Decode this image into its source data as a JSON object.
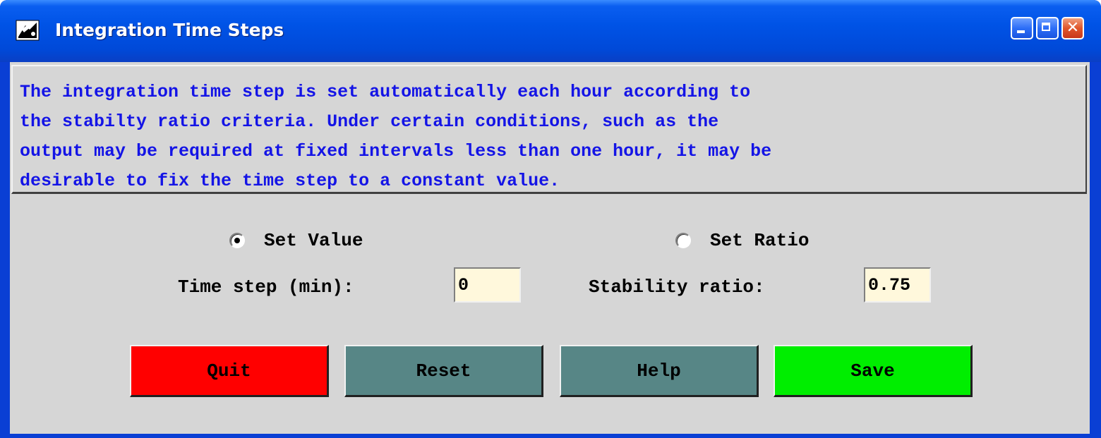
{
  "window": {
    "title": "Integration Time Steps",
    "icon": "app-icon",
    "controls": [
      "minimize-icon",
      "maximize-icon",
      "close-icon"
    ],
    "close_glyph": "✕"
  },
  "info": {
    "lines": [
      "The integration time step is set automatically each hour according to",
      "the stabilty ratio criteria. Under certain conditions, such as the",
      "output may be required at fixed intervals less than one hour, it may be",
      "desirable to fix the time step to a constant value."
    ],
    "color": "#1414e6"
  },
  "options": {
    "set_value_label": "Set Value",
    "set_value_checked": true,
    "set_ratio_label": "Set Ratio",
    "set_ratio_checked": false
  },
  "fields": {
    "time_step_label": "Time step (min):",
    "time_step_value": "0",
    "stability_label": "Stability ratio:",
    "stability_value": "0.75",
    "field_bg": "#fff8dc"
  },
  "buttons": {
    "quit": {
      "label": "Quit",
      "color": "#ff0000"
    },
    "reset": {
      "label": "Reset",
      "color": "#578686"
    },
    "help": {
      "label": "Help",
      "color": "#578686"
    },
    "save": {
      "label": "Save",
      "color": "#00ee00"
    }
  }
}
